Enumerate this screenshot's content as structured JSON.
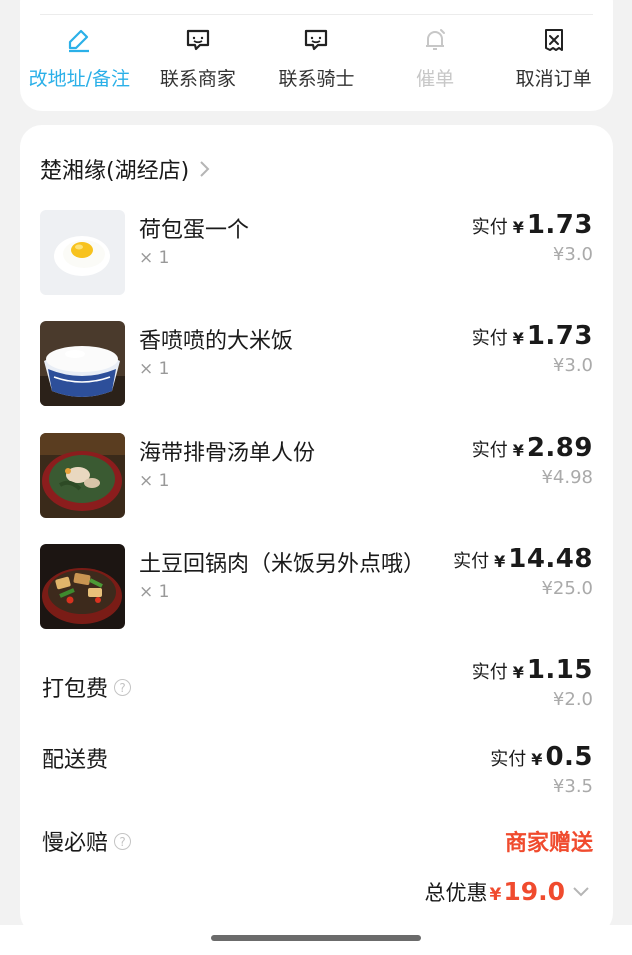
{
  "actions": [
    {
      "label": "改地址/备注",
      "icon": "edit-icon"
    },
    {
      "label": "联系商家",
      "icon": "chat-icon"
    },
    {
      "label": "联系骑士",
      "icon": "chat-icon"
    },
    {
      "label": "催单",
      "icon": "bell-icon"
    },
    {
      "label": "取消订单",
      "icon": "cancel-order-icon"
    }
  ],
  "store": {
    "name": "楚湘缘(湖经店)"
  },
  "items": [
    {
      "name": "荷包蛋一个",
      "qty": "× 1",
      "paid_label": "实付",
      "currency": "¥",
      "paid": "1.73",
      "original": "¥3.0",
      "image": "fried-egg"
    },
    {
      "name": "香喷喷的大米饭",
      "qty": "× 1",
      "paid_label": "实付",
      "currency": "¥",
      "paid": "1.73",
      "original": "¥3.0",
      "image": "rice-bowl"
    },
    {
      "name": "海带排骨汤单人份",
      "qty": "× 1",
      "paid_label": "实付",
      "currency": "¥",
      "paid": "2.89",
      "original": "¥4.98",
      "image": "kelp-rib-soup"
    },
    {
      "name": "土豆回锅肉（米饭另外点哦）",
      "qty": "× 1",
      "paid_label": "实付",
      "currency": "¥",
      "paid": "14.48",
      "original": "¥25.0",
      "image": "twice-cooked-pork"
    }
  ],
  "fees": {
    "packing": {
      "label": "打包费",
      "paid_label": "实付",
      "currency": "¥",
      "paid": "1.15",
      "original": "¥2.0"
    },
    "delivery": {
      "label": "配送费",
      "paid_label": "实付",
      "currency": "¥",
      "paid": "0.5",
      "original": "¥3.5"
    },
    "late": {
      "label": "慢必赔",
      "value": "商家赠送"
    }
  },
  "total_discount": {
    "label": "总优惠",
    "currency": "¥",
    "amount": "19.0"
  },
  "colors": {
    "accent": "#2bb0e8",
    "discount": "#f04b2e",
    "muted": "#aaaaaa"
  }
}
